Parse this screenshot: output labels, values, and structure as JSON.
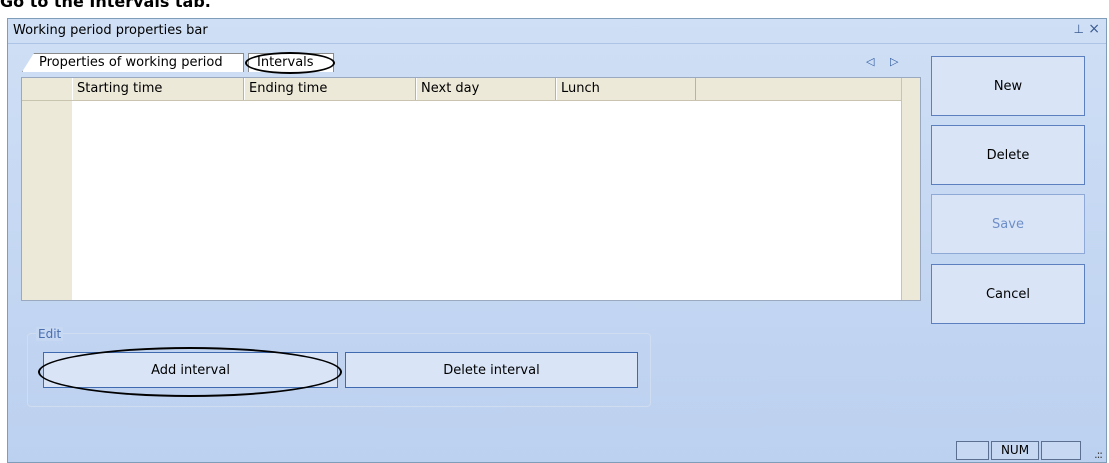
{
  "caption": "Go to the Intervals tab.",
  "panel": {
    "title": "Working period properties bar",
    "pin_glyph": "⊥",
    "close_glyph": "×",
    "tabs": [
      {
        "label": "Properties of working period"
      },
      {
        "label": "Intervals"
      }
    ],
    "tab_scroll_glyph": "◁ ▷"
  },
  "grid": {
    "columns": [
      "Starting time",
      "Ending time",
      "Next day",
      "Lunch"
    ]
  },
  "buttons": {
    "new": "New",
    "delete": "Delete",
    "save": "Save",
    "cancel": "Cancel"
  },
  "edit_group": {
    "label": "Edit",
    "add_interval": "Add interval",
    "delete_interval": "Delete interval"
  },
  "statusbar": {
    "num": "NUM",
    "grip_glyph": ".::"
  },
  "colors": {
    "panel_bg": "#c3d6f2",
    "button_border": "#5b7fbf",
    "disabled_text": "#6f8fc8",
    "grid_header_bg": "#ece9d8"
  },
  "icons": [
    "pin-icon",
    "close-icon",
    "tab-scroll-arrows-icon",
    "resize-grip-icon"
  ]
}
